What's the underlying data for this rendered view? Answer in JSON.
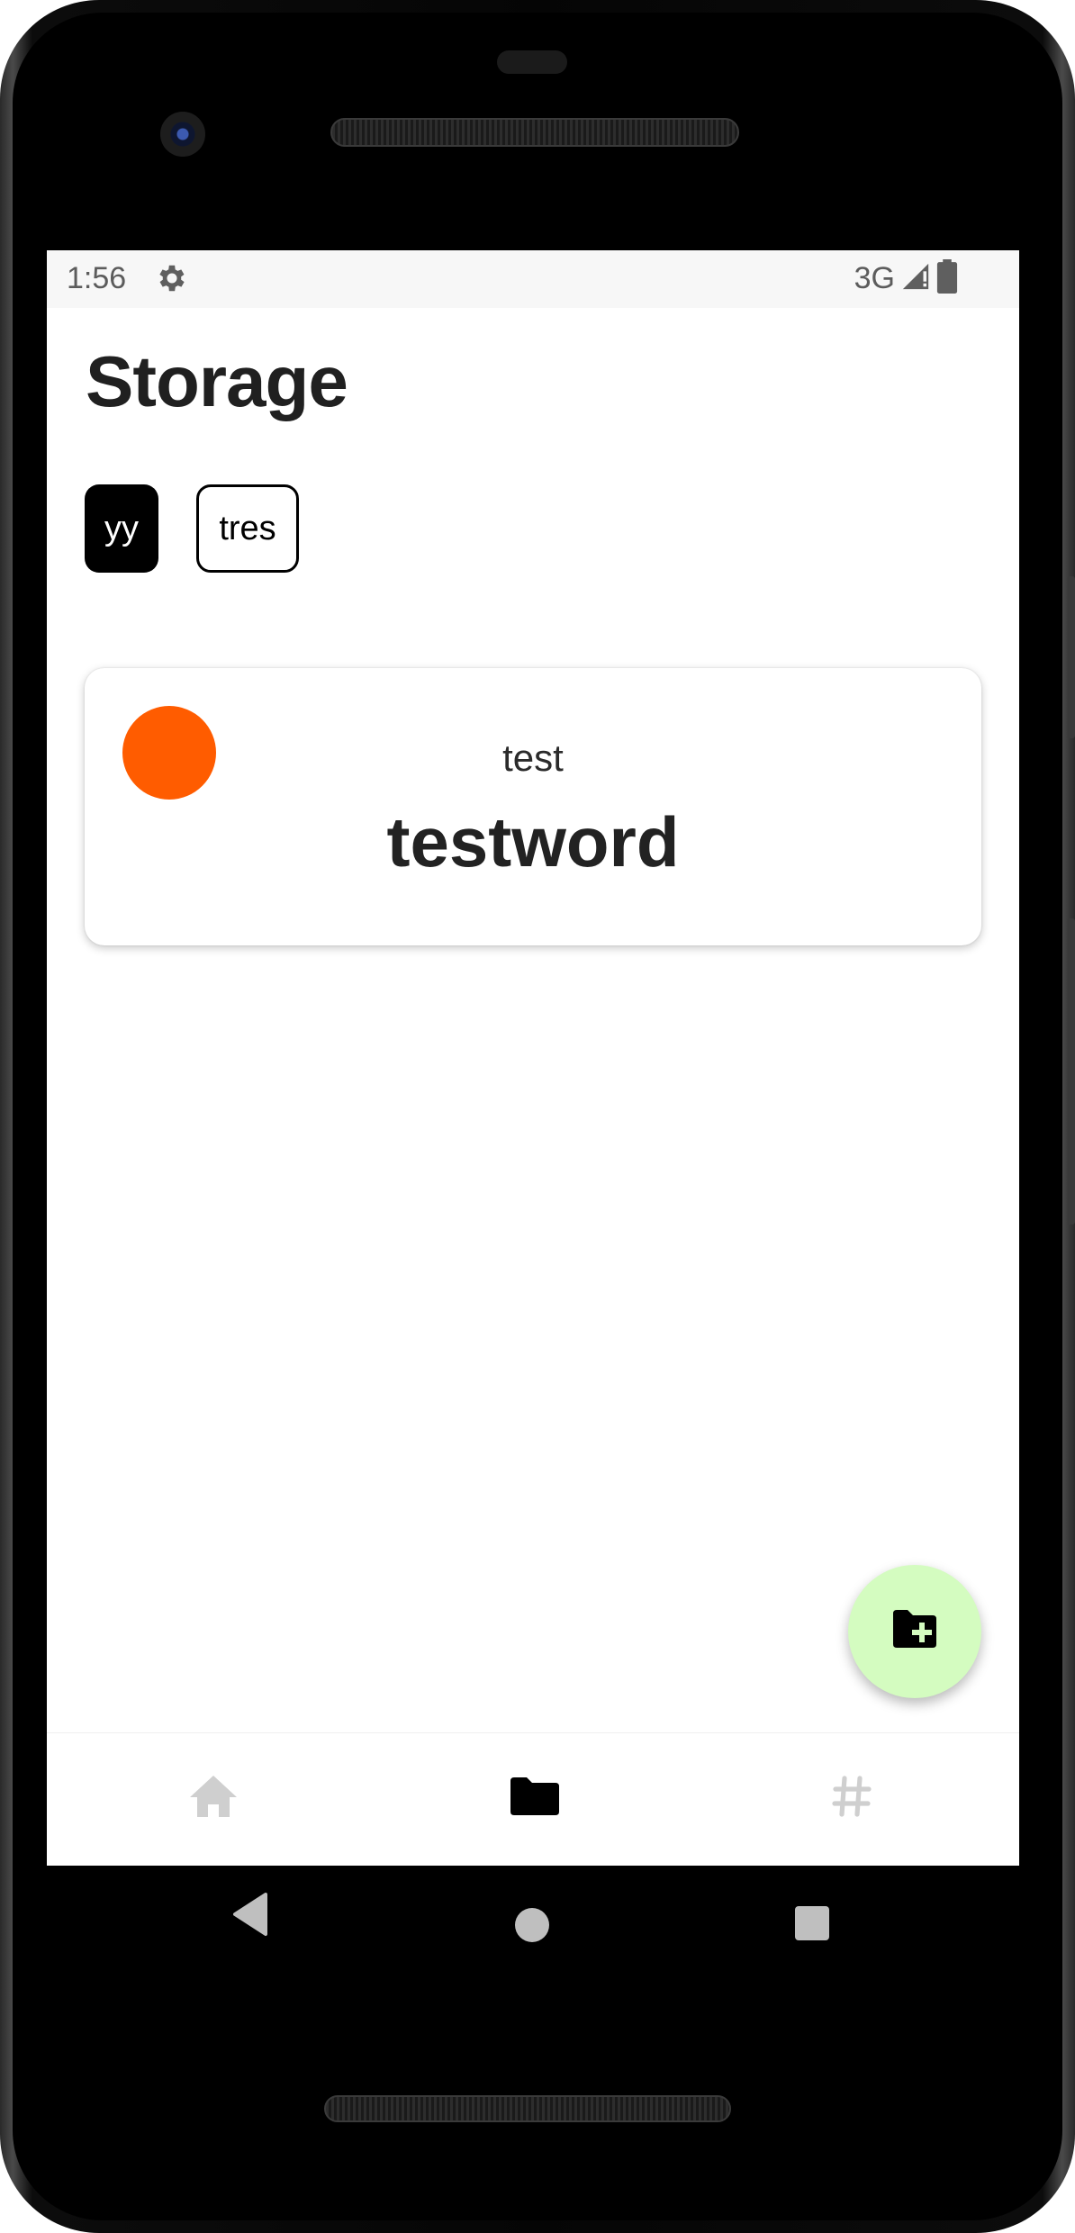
{
  "statusbar": {
    "time": "1:56",
    "network": "3G",
    "icons": [
      "settings-icon",
      "signal-icon",
      "battery-icon"
    ]
  },
  "page": {
    "title": "Storage"
  },
  "filters": [
    {
      "label": "yy",
      "selected": true
    },
    {
      "label": "tres",
      "selected": false
    }
  ],
  "card": {
    "subtitle": "test",
    "word": "testword",
    "dot_color": "#ff5c00"
  },
  "fab": {
    "icon": "create-folder-icon",
    "background": "#d4fcc0"
  },
  "bottom_nav": {
    "items": [
      {
        "icon": "home-icon",
        "active": false
      },
      {
        "icon": "folder-icon",
        "active": true
      },
      {
        "icon": "hashtag-icon",
        "active": false
      }
    ]
  },
  "system_nav": [
    "back-icon",
    "home-circle-icon",
    "recents-icon"
  ],
  "colors": {
    "inactive_icon": "#cfcfcf",
    "active_icon": "#000000"
  }
}
